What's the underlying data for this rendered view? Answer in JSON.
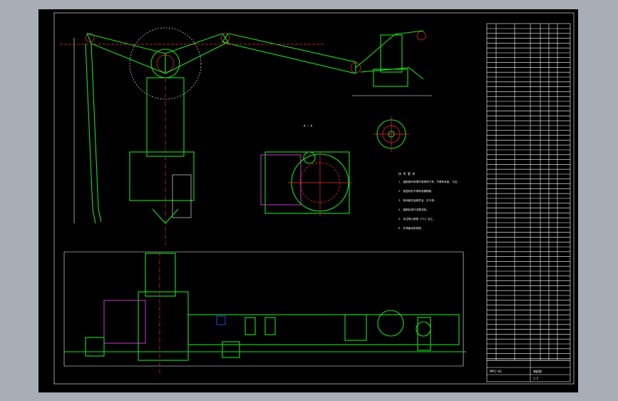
{
  "drawing": {
    "section_label": "A — A",
    "notes_title": "技 术 要 求",
    "notes": [
      "1. 装配前所有零件须清洗干净，不得有毛刺、飞边。",
      "2. 各密封处不得有渗漏现象。",
      "3. 转动部位运转灵活，无卡滞。",
      "4. 装配后进行空载试验。",
      "5. 未注明公差按 IT12 加工。",
      "6. 外表面涂防锈漆。"
    ],
    "title_block": {
      "drawing_no": "PMYJ-01",
      "name": "装配图",
      "scale": "1:5"
    },
    "colors": {
      "outline": "#18e018",
      "center": "#ff2a2a",
      "text": "#ffffff",
      "hidden": "#e040e0",
      "accent": "#3050ff"
    }
  }
}
